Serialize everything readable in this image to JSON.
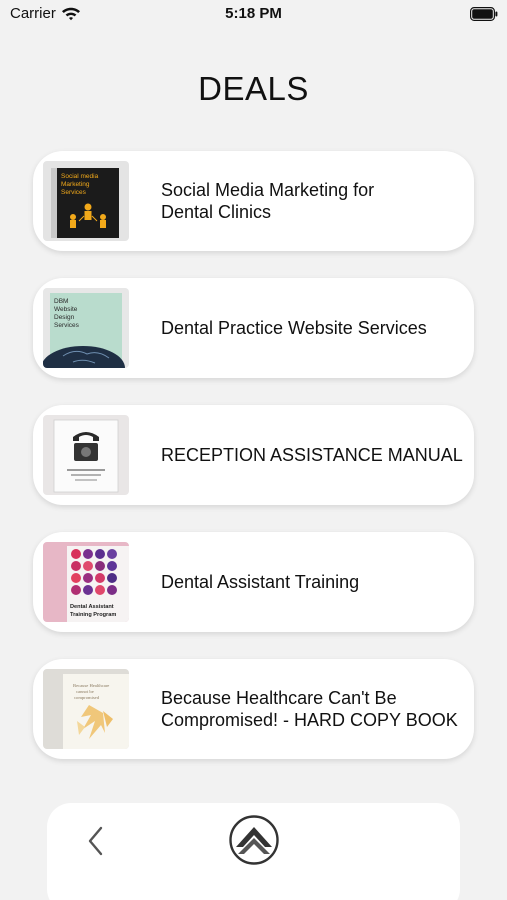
{
  "status_bar": {
    "carrier": "Carrier",
    "time": "5:18 PM",
    "icons": [
      "wifi-icon",
      "battery-icon"
    ]
  },
  "page": {
    "title": "DEALS"
  },
  "deals": [
    {
      "label": "Social Media Marketing  for\nDental Clinics",
      "thumb_text": "Social media Marketing Services"
    },
    {
      "label": "Dental Practice Website Services",
      "thumb_text": "DBM Website Design Services"
    },
    {
      "label": "RECEPTION ASSISTANCE MANUAL",
      "thumb_text": ""
    },
    {
      "label": "Dental Assistant Training",
      "thumb_text": "Dental Assistant Training Program"
    },
    {
      "label": "Because Healthcare Can't Be\nCompromised! - HARD COPY BOOK",
      "thumb_text": "Because Healthcare cannot be compromised"
    }
  ],
  "bottom_bar": {
    "icons": [
      "chevron-left-icon",
      "app-logo-icon"
    ]
  },
  "colors": {
    "background": "#f2f2f2",
    "card": "#ffffff",
    "text": "#111111"
  }
}
